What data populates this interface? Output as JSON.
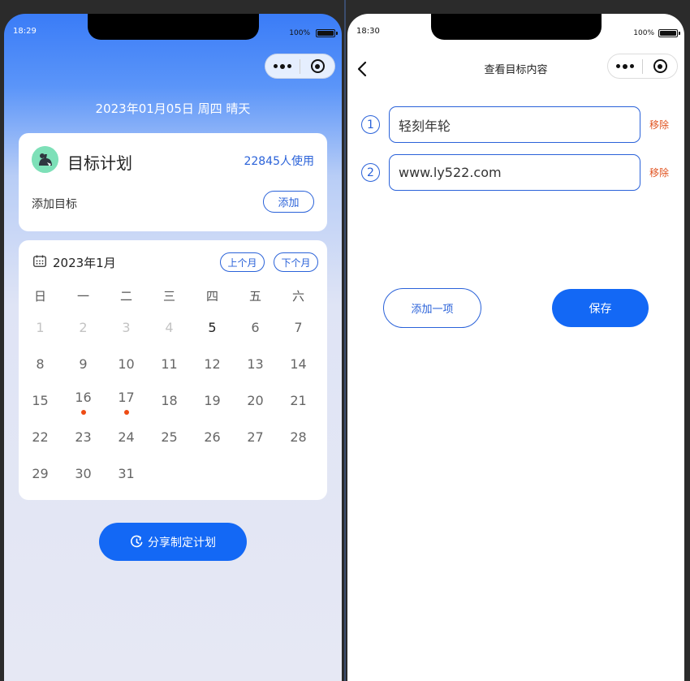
{
  "left": {
    "status": {
      "time": "18:29",
      "battery": "100%"
    },
    "date_line": "2023年01月05日 周四 晴天",
    "plan_card": {
      "title": "目标计划",
      "users": "22845人使用",
      "add_goal_label": "添加目标",
      "add_button": "添加"
    },
    "calendar": {
      "title": "2023年1月",
      "prev_month": "上个月",
      "next_month": "下个月",
      "weekdays": [
        "日",
        "一",
        "二",
        "三",
        "四",
        "五",
        "六"
      ],
      "days": [
        {
          "label": "1",
          "state": "muted"
        },
        {
          "label": "2",
          "state": "muted"
        },
        {
          "label": "3",
          "state": "muted"
        },
        {
          "label": "4",
          "state": "muted"
        },
        {
          "label": "5",
          "state": "today"
        },
        {
          "label": "6",
          "state": "normal"
        },
        {
          "label": "7",
          "state": "normal"
        },
        {
          "label": "8",
          "state": "normal"
        },
        {
          "label": "9",
          "state": "normal"
        },
        {
          "label": "10",
          "state": "normal"
        },
        {
          "label": "11",
          "state": "normal"
        },
        {
          "label": "12",
          "state": "normal"
        },
        {
          "label": "13",
          "state": "normal"
        },
        {
          "label": "14",
          "state": "normal"
        },
        {
          "label": "15",
          "state": "normal"
        },
        {
          "label": "16",
          "state": "marked"
        },
        {
          "label": "17",
          "state": "marked"
        },
        {
          "label": "18",
          "state": "normal"
        },
        {
          "label": "19",
          "state": "normal"
        },
        {
          "label": "20",
          "state": "normal"
        },
        {
          "label": "21",
          "state": "normal"
        },
        {
          "label": "22",
          "state": "normal"
        },
        {
          "label": "23",
          "state": "normal"
        },
        {
          "label": "24",
          "state": "normal"
        },
        {
          "label": "25",
          "state": "normal"
        },
        {
          "label": "26",
          "state": "normal"
        },
        {
          "label": "27",
          "state": "normal"
        },
        {
          "label": "28",
          "state": "normal"
        },
        {
          "label": "29",
          "state": "normal"
        },
        {
          "label": "30",
          "state": "normal"
        },
        {
          "label": "31",
          "state": "normal"
        }
      ]
    },
    "share_button": "分享制定计划"
  },
  "right": {
    "status": {
      "time": "18:30",
      "battery": "100%"
    },
    "nav_title": "查看目标内容",
    "items": [
      {
        "number": "1",
        "value": "轻刻年轮",
        "remove": "移除"
      },
      {
        "number": "2",
        "value": "www.ly522.com",
        "remove": "移除"
      }
    ],
    "add_item_button": "添加一项",
    "save_button": "保存"
  },
  "colors": {
    "accent": "#1368f5",
    "link": "#2a62d9",
    "remove": "#e0521f",
    "marker_dot": "#ee4b14"
  },
  "icons": [
    "more-icon",
    "close-capsule-icon",
    "calendar-icon",
    "share-icon",
    "back-arrow-icon",
    "avatar-icon"
  ]
}
